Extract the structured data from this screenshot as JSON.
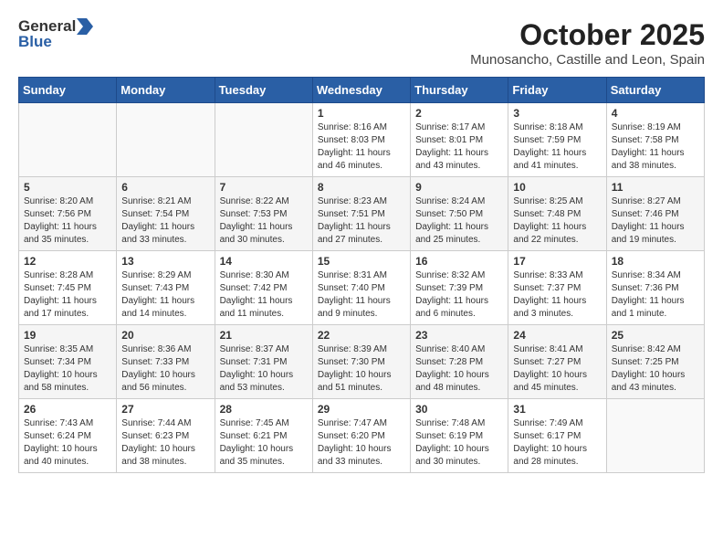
{
  "logo": {
    "general": "General",
    "blue": "Blue"
  },
  "title": "October 2025",
  "subtitle": "Munosancho, Castille and Leon, Spain",
  "headers": [
    "Sunday",
    "Monday",
    "Tuesday",
    "Wednesday",
    "Thursday",
    "Friday",
    "Saturday"
  ],
  "weeks": [
    [
      {
        "day": "",
        "info": ""
      },
      {
        "day": "",
        "info": ""
      },
      {
        "day": "",
        "info": ""
      },
      {
        "day": "1",
        "info": "Sunrise: 8:16 AM\nSunset: 8:03 PM\nDaylight: 11 hours and 46 minutes."
      },
      {
        "day": "2",
        "info": "Sunrise: 8:17 AM\nSunset: 8:01 PM\nDaylight: 11 hours and 43 minutes."
      },
      {
        "day": "3",
        "info": "Sunrise: 8:18 AM\nSunset: 7:59 PM\nDaylight: 11 hours and 41 minutes."
      },
      {
        "day": "4",
        "info": "Sunrise: 8:19 AM\nSunset: 7:58 PM\nDaylight: 11 hours and 38 minutes."
      }
    ],
    [
      {
        "day": "5",
        "info": "Sunrise: 8:20 AM\nSunset: 7:56 PM\nDaylight: 11 hours and 35 minutes."
      },
      {
        "day": "6",
        "info": "Sunrise: 8:21 AM\nSunset: 7:54 PM\nDaylight: 11 hours and 33 minutes."
      },
      {
        "day": "7",
        "info": "Sunrise: 8:22 AM\nSunset: 7:53 PM\nDaylight: 11 hours and 30 minutes."
      },
      {
        "day": "8",
        "info": "Sunrise: 8:23 AM\nSunset: 7:51 PM\nDaylight: 11 hours and 27 minutes."
      },
      {
        "day": "9",
        "info": "Sunrise: 8:24 AM\nSunset: 7:50 PM\nDaylight: 11 hours and 25 minutes."
      },
      {
        "day": "10",
        "info": "Sunrise: 8:25 AM\nSunset: 7:48 PM\nDaylight: 11 hours and 22 minutes."
      },
      {
        "day": "11",
        "info": "Sunrise: 8:27 AM\nSunset: 7:46 PM\nDaylight: 11 hours and 19 minutes."
      }
    ],
    [
      {
        "day": "12",
        "info": "Sunrise: 8:28 AM\nSunset: 7:45 PM\nDaylight: 11 hours and 17 minutes."
      },
      {
        "day": "13",
        "info": "Sunrise: 8:29 AM\nSunset: 7:43 PM\nDaylight: 11 hours and 14 minutes."
      },
      {
        "day": "14",
        "info": "Sunrise: 8:30 AM\nSunset: 7:42 PM\nDaylight: 11 hours and 11 minutes."
      },
      {
        "day": "15",
        "info": "Sunrise: 8:31 AM\nSunset: 7:40 PM\nDaylight: 11 hours and 9 minutes."
      },
      {
        "day": "16",
        "info": "Sunrise: 8:32 AM\nSunset: 7:39 PM\nDaylight: 11 hours and 6 minutes."
      },
      {
        "day": "17",
        "info": "Sunrise: 8:33 AM\nSunset: 7:37 PM\nDaylight: 11 hours and 3 minutes."
      },
      {
        "day": "18",
        "info": "Sunrise: 8:34 AM\nSunset: 7:36 PM\nDaylight: 11 hours and 1 minute."
      }
    ],
    [
      {
        "day": "19",
        "info": "Sunrise: 8:35 AM\nSunset: 7:34 PM\nDaylight: 10 hours and 58 minutes."
      },
      {
        "day": "20",
        "info": "Sunrise: 8:36 AM\nSunset: 7:33 PM\nDaylight: 10 hours and 56 minutes."
      },
      {
        "day": "21",
        "info": "Sunrise: 8:37 AM\nSunset: 7:31 PM\nDaylight: 10 hours and 53 minutes."
      },
      {
        "day": "22",
        "info": "Sunrise: 8:39 AM\nSunset: 7:30 PM\nDaylight: 10 hours and 51 minutes."
      },
      {
        "day": "23",
        "info": "Sunrise: 8:40 AM\nSunset: 7:28 PM\nDaylight: 10 hours and 48 minutes."
      },
      {
        "day": "24",
        "info": "Sunrise: 8:41 AM\nSunset: 7:27 PM\nDaylight: 10 hours and 45 minutes."
      },
      {
        "day": "25",
        "info": "Sunrise: 8:42 AM\nSunset: 7:25 PM\nDaylight: 10 hours and 43 minutes."
      }
    ],
    [
      {
        "day": "26",
        "info": "Sunrise: 7:43 AM\nSunset: 6:24 PM\nDaylight: 10 hours and 40 minutes."
      },
      {
        "day": "27",
        "info": "Sunrise: 7:44 AM\nSunset: 6:23 PM\nDaylight: 10 hours and 38 minutes."
      },
      {
        "day": "28",
        "info": "Sunrise: 7:45 AM\nSunset: 6:21 PM\nDaylight: 10 hours and 35 minutes."
      },
      {
        "day": "29",
        "info": "Sunrise: 7:47 AM\nSunset: 6:20 PM\nDaylight: 10 hours and 33 minutes."
      },
      {
        "day": "30",
        "info": "Sunrise: 7:48 AM\nSunset: 6:19 PM\nDaylight: 10 hours and 30 minutes."
      },
      {
        "day": "31",
        "info": "Sunrise: 7:49 AM\nSunset: 6:17 PM\nDaylight: 10 hours and 28 minutes."
      },
      {
        "day": "",
        "info": ""
      }
    ]
  ]
}
